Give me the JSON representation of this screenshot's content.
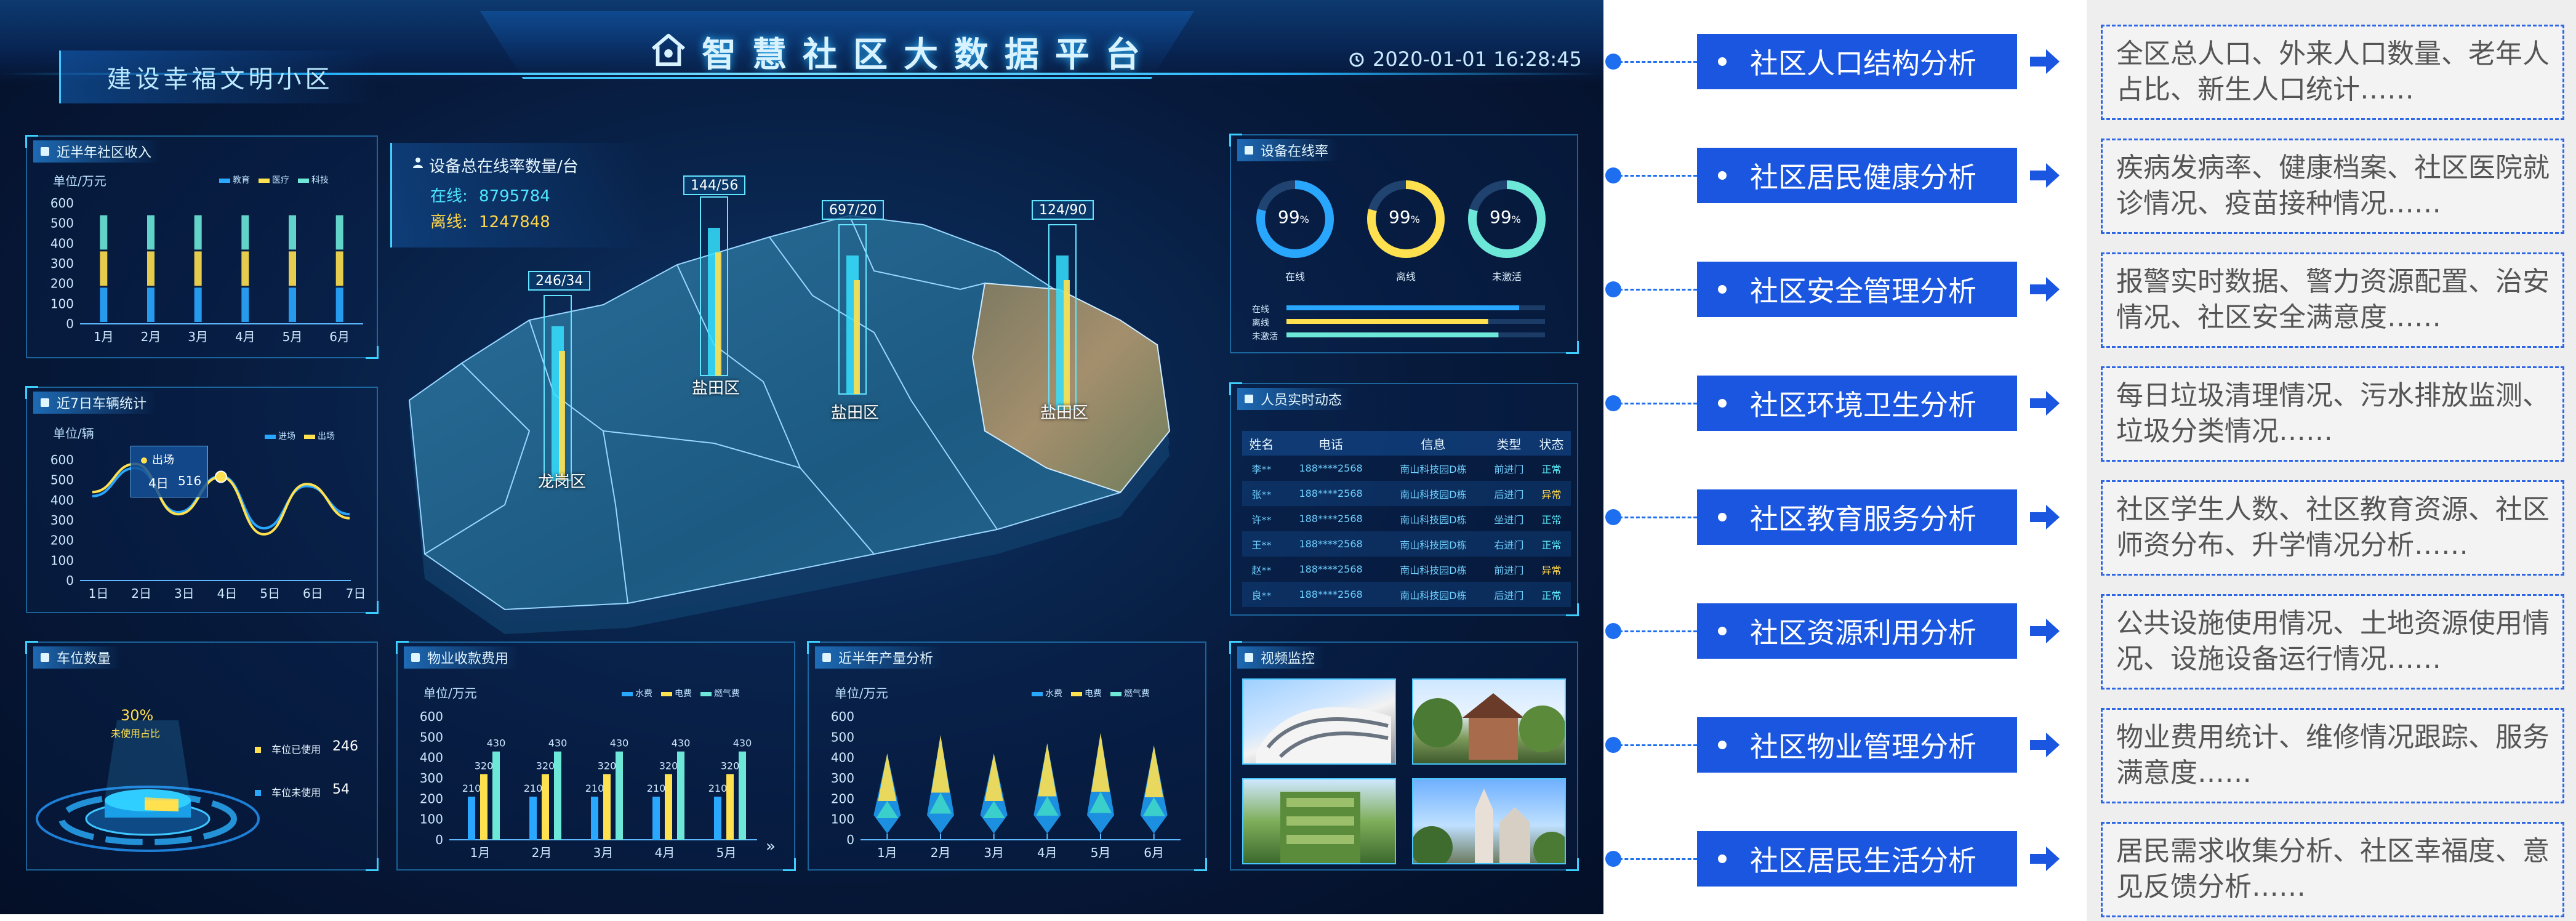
{
  "header": {
    "slogan": "建设幸福文明小区",
    "title": "智慧社区大数据平台",
    "datetime": "2020-01-01 16:28:45"
  },
  "income_panel": {
    "title": "近半年社区收入",
    "unit": "单位/万元",
    "legend": [
      "教育",
      "医疗",
      "科技"
    ],
    "chart_data": {
      "type": "bar",
      "categories": [
        "1月",
        "2月",
        "3月",
        "4月",
        "5月",
        "6月"
      ],
      "y_ticks": [
        0,
        100,
        200,
        300,
        400,
        500,
        600
      ],
      "ylim": [
        0,
        600
      ],
      "series": [
        {
          "name": "教育",
          "values": [
            540,
            540,
            540,
            540,
            540,
            540
          ]
        },
        {
          "name": "医疗",
          "values": [
            540,
            540,
            540,
            540,
            540,
            540
          ]
        },
        {
          "name": "科技",
          "values": [
            540,
            540,
            540,
            540,
            540,
            540
          ]
        }
      ]
    }
  },
  "vehicle_panel": {
    "title": "近7日车辆统计",
    "unit": "单位/辆",
    "legend": [
      "进场",
      "出场"
    ],
    "tooltip": {
      "series": "出场",
      "day": "4日",
      "value": "516"
    },
    "chart_data": {
      "type": "line",
      "categories": [
        "1日",
        "2日",
        "3日",
        "4日",
        "5日",
        "6日",
        "7日"
      ],
      "y_ticks": [
        0,
        100,
        200,
        300,
        400,
        500,
        600
      ],
      "ylim": [
        0,
        600
      ],
      "series": [
        {
          "name": "进场",
          "values": [
            420,
            560,
            340,
            520,
            260,
            470,
            330
          ]
        },
        {
          "name": "出场",
          "values": [
            440,
            580,
            330,
            516,
            230,
            480,
            310
          ]
        }
      ]
    }
  },
  "device_summary": {
    "title": "设备总在线率数量/台",
    "online_label": "在线:",
    "online_value": "8795784",
    "offline_label": "离线:",
    "offline_value": "1247848"
  },
  "map": {
    "chart_data": {
      "type": "bar",
      "categories": [
        "龙岗区",
        "盐田区",
        "盐田区",
        "盐田区"
      ],
      "tags": [
        "246/34",
        "144/56",
        "697/20",
        "124/90"
      ]
    },
    "labels": [
      "龙岗区",
      "盐田区",
      "盐田区",
      "盐田区"
    ]
  },
  "online_panel": {
    "title": "设备在线率",
    "rings": [
      {
        "label": "在线",
        "value": "99",
        "unit": "%",
        "fraction": 0.99,
        "color": "#29a7ff"
      },
      {
        "label": "离线",
        "value": "99",
        "unit": "%",
        "fraction": 0.99,
        "color": "#ffe04f"
      },
      {
        "label": "未激活",
        "value": "99",
        "unit": "%",
        "fraction": 0.99,
        "color": "#6de8d8"
      }
    ],
    "bars": [
      {
        "label": "在线",
        "fraction": 0.9,
        "color": "#29a7ff"
      },
      {
        "label": "离线",
        "fraction": 0.78,
        "color": "#ffe04f"
      },
      {
        "label": "未激活",
        "fraction": 0.82,
        "color": "#6de8d8"
      }
    ]
  },
  "people_panel": {
    "title": "人员实时动态",
    "columns": [
      "姓名",
      "电话",
      "信息",
      "类型",
      "状态"
    ],
    "rows": [
      {
        "name": "李**",
        "phone": "188****2568",
        "info": "南山科技园D栋",
        "type": "前进门",
        "status": "正常"
      },
      {
        "name": "张**",
        "phone": "188****2568",
        "info": "南山科技园D栋",
        "type": "后进门",
        "status": "异常"
      },
      {
        "name": "许**",
        "phone": "188****2568",
        "info": "南山科技园D栋",
        "type": "坐进门",
        "status": "正常"
      },
      {
        "name": "王**",
        "phone": "188****2568",
        "info": "南山科技园D栋",
        "type": "右进门",
        "status": "正常"
      },
      {
        "name": "赵**",
        "phone": "188****2568",
        "info": "南山科技园D栋",
        "type": "前进门",
        "status": "异常"
      },
      {
        "name": "良**",
        "phone": "188****2568",
        "info": "南山科技园D栋",
        "type": "后进门",
        "status": "正常"
      }
    ]
  },
  "parking_panel": {
    "title": "车位数量",
    "percent": "30%",
    "caption": "未使用占比",
    "items": [
      {
        "label": "车位已使用",
        "value": "246",
        "color": "#ffe04f"
      },
      {
        "label": "车位未使用",
        "value": "54",
        "color": "#2aa8ff"
      }
    ]
  },
  "fee_panel": {
    "title": "物业收款费用",
    "unit": "单位/万元",
    "legend": [
      "水费",
      "电费",
      "燃气费"
    ],
    "more": "»",
    "chart_data": {
      "type": "bar",
      "categories": [
        "1月",
        "2月",
        "3月",
        "4月",
        "5月"
      ],
      "y_ticks": [
        0,
        100,
        200,
        300,
        400,
        500,
        600
      ],
      "ylim": [
        0,
        600
      ],
      "series": [
        {
          "name": "水费",
          "values": [
            210,
            210,
            210,
            210,
            210
          ]
        },
        {
          "name": "电费",
          "values": [
            320,
            320,
            320,
            320,
            320
          ]
        },
        {
          "name": "燃气费",
          "values": [
            430,
            430,
            430,
            430,
            430
          ]
        }
      ]
    }
  },
  "output_panel": {
    "title": "近半年产量分析",
    "unit": "单位/万元",
    "legend": [
      "水费",
      "电费",
      "燃气费"
    ],
    "chart_data": {
      "type": "bar",
      "categories": [
        "1月",
        "2月",
        "3月",
        "4月",
        "5月",
        "6月"
      ],
      "y_ticks": [
        0,
        100,
        200,
        300,
        400,
        500,
        600
      ],
      "ylim": [
        0,
        600
      ],
      "values": [
        420,
        510,
        420,
        470,
        520,
        460
      ]
    }
  },
  "video_panel": {
    "title": "视频监控"
  },
  "categories": [
    {
      "label": "社区人口结构分析",
      "desc": "全区总人口、外来人口数量、老年人占比、新生人口统计……"
    },
    {
      "label": "社区居民健康分析",
      "desc": "疾病发病率、健康档案、社区医院就诊情况、疫苗接种情况……"
    },
    {
      "label": "社区安全管理分析",
      "desc": "报警实时数据、警力资源配置、治安情况、社区安全满意度……"
    },
    {
      "label": "社区环境卫生分析",
      "desc": "每日垃圾清理情况、污水排放监测、垃圾分类情况……"
    },
    {
      "label": "社区教育服务分析",
      "desc": "社区学生人数、社区教育资源、社区师资分布、升学情况分析……"
    },
    {
      "label": "社区资源利用分析",
      "desc": "公共设施使用情况、土地资源使用情况、设施设备运行情况……"
    },
    {
      "label": "社区物业管理分析",
      "desc": "物业费用统计、维修情况跟踪、服务满意度……"
    },
    {
      "label": "社区居民生活分析",
      "desc": "居民需求收集分析、社区幸福度、意见反馈分析……"
    }
  ]
}
